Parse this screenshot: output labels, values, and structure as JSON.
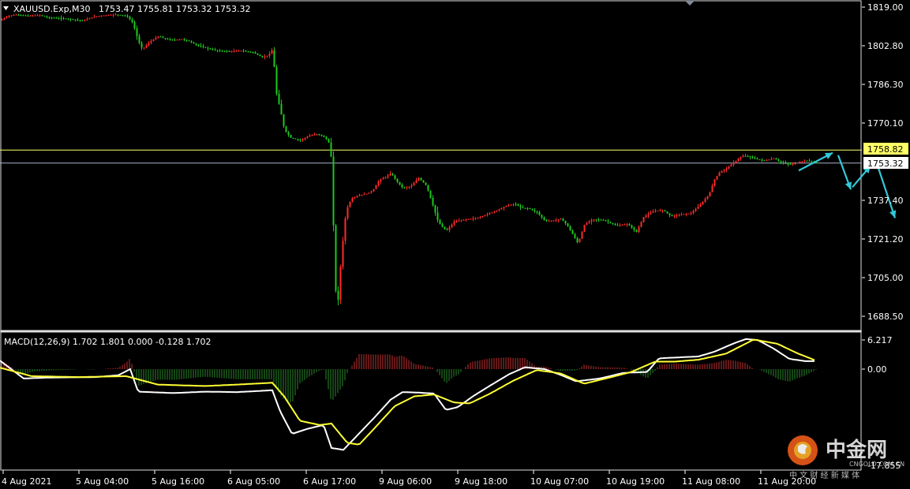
{
  "header": {
    "symbol_label": "XAUUSD.Exp,M30",
    "ohlc_label": "1753.47 1755.81 1753.32 1753.32",
    "menu_icon": "triangle-down-icon"
  },
  "macd": {
    "label": "MACD(12,26,9) 1.702 1.801 0.000 -0.128 1.702",
    "axis_top": "6.217",
    "axis_zero": "0.00",
    "axis_bottom": "-17.855"
  },
  "price_axis": {
    "ticks": [
      "1819.00",
      "1802.80",
      "1786.30",
      "1770.10",
      "1737.40",
      "1721.20",
      "1705.00",
      "1688.50"
    ],
    "resistance_label": "1758.82",
    "current_label": "1753.32"
  },
  "time_axis": {
    "ticks": [
      "4 Aug 2021",
      "5 Aug 04:00",
      "5 Aug 16:00",
      "6 Aug 05:00",
      "6 Aug 17:00",
      "9 Aug 06:00",
      "9 Aug 18:00",
      "10 Aug 07:00",
      "10 Aug 19:00",
      "11 Aug 08:00",
      "11 Aug 20:00"
    ]
  },
  "watermark": {
    "name_cn": "中金网",
    "sub_cn": "中 文 财 经 新 媒 体",
    "domain": "CNGOLD.COM.CN"
  },
  "colors": {
    "bull": "#ff2a2a",
    "bear": "#1ec81e",
    "resistance_line": "#ffff66",
    "current_line": "#a8b4c8",
    "forecast_arrow": "#33c8d8",
    "macd_main": "#ffffff",
    "macd_signal": "#ffff33",
    "hist_pos": "#c83030",
    "hist_neg": "#2a8a2a",
    "logo_accent": "#e85a1a"
  },
  "chart_data": {
    "type": "candlestick",
    "instrument": "XAUUSD.Exp",
    "timeframe": "M30",
    "y_range": [
      1681,
      1823
    ],
    "resistance_level": 1758.82,
    "current_price": 1753.32,
    "price_path_anchors": [
      [
        0,
        1813.4
      ],
      [
        10,
        1815.3
      ],
      [
        20,
        1815.8
      ],
      [
        35,
        1815.3
      ],
      [
        50,
        1815.6
      ],
      [
        60,
        1814.6
      ],
      [
        75,
        1814.3
      ],
      [
        90,
        1813.9
      ],
      [
        105,
        1813.2
      ],
      [
        115,
        1814.6
      ],
      [
        125,
        1815.3
      ],
      [
        135,
        1815.6
      ],
      [
        145,
        1815.9
      ],
      [
        160,
        1815.3
      ],
      [
        168,
        1812.3
      ],
      [
        175,
        1804.5
      ],
      [
        180,
        1801.3
      ],
      [
        190,
        1804.5
      ],
      [
        200,
        1806.6
      ],
      [
        210,
        1805.5
      ],
      [
        220,
        1805.1
      ],
      [
        230,
        1805.5
      ],
      [
        240,
        1804.5
      ],
      [
        250,
        1802.8
      ],
      [
        260,
        1801.8
      ],
      [
        275,
        1800.6
      ],
      [
        290,
        1800.3
      ],
      [
        305,
        1800.6
      ],
      [
        320,
        1799.9
      ],
      [
        332,
        1797.8
      ],
      [
        340,
        1798.7
      ],
      [
        345,
        1801.3
      ],
      [
        350,
        1782.4
      ],
      [
        355,
        1775.3
      ],
      [
        360,
        1767.1
      ],
      [
        368,
        1763.8
      ],
      [
        380,
        1762.8
      ],
      [
        392,
        1764.8
      ],
      [
        402,
        1765.5
      ],
      [
        412,
        1763.8
      ],
      [
        418,
        1760.9
      ],
      [
        420,
        1750.9
      ],
      [
        422,
        1726.9
      ],
      [
        424,
        1700.5
      ],
      [
        428,
        1695.5
      ],
      [
        432,
        1714.0
      ],
      [
        438,
        1733.0
      ],
      [
        445,
        1738.3
      ],
      [
        455,
        1739.6
      ],
      [
        465,
        1740.3
      ],
      [
        472,
        1741.6
      ],
      [
        480,
        1745.9
      ],
      [
        488,
        1747.3
      ],
      [
        495,
        1748.9
      ],
      [
        502,
        1745.6
      ],
      [
        510,
        1742.6
      ],
      [
        520,
        1743.3
      ],
      [
        530,
        1746.9
      ],
      [
        540,
        1743.6
      ],
      [
        548,
        1735.4
      ],
      [
        555,
        1728.1
      ],
      [
        565,
        1724.5
      ],
      [
        575,
        1728.4
      ],
      [
        590,
        1729.4
      ],
      [
        605,
        1730.0
      ],
      [
        620,
        1732.0
      ],
      [
        630,
        1733.3
      ],
      [
        640,
        1735.0
      ],
      [
        652,
        1736.0
      ],
      [
        660,
        1734.3
      ],
      [
        670,
        1734.0
      ],
      [
        680,
        1732.4
      ],
      [
        690,
        1728.8
      ],
      [
        700,
        1728.8
      ],
      [
        710,
        1729.7
      ],
      [
        718,
        1727.1
      ],
      [
        725,
        1723.2
      ],
      [
        732,
        1719.2
      ],
      [
        740,
        1727.1
      ],
      [
        750,
        1729.4
      ],
      [
        765,
        1729.1
      ],
      [
        780,
        1726.8
      ],
      [
        795,
        1727.4
      ],
      [
        806,
        1724.1
      ],
      [
        815,
        1730.4
      ],
      [
        828,
        1733.0
      ],
      [
        840,
        1733.3
      ],
      [
        850,
        1730.7
      ],
      [
        860,
        1731.4
      ],
      [
        875,
        1732.0
      ],
      [
        888,
        1736.0
      ],
      [
        898,
        1740.0
      ],
      [
        905,
        1746.3
      ],
      [
        912,
        1749.5
      ],
      [
        920,
        1750.9
      ],
      [
        930,
        1753.6
      ],
      [
        940,
        1756.2
      ],
      [
        950,
        1755.9
      ],
      [
        960,
        1754.6
      ],
      [
        970,
        1754.3
      ],
      [
        980,
        1755.2
      ],
      [
        990,
        1753.3
      ],
      [
        1000,
        1752.6
      ],
      [
        1010,
        1753.3
      ],
      [
        1020,
        1754.3
      ],
      [
        1034,
        1753.32
      ]
    ],
    "forecast_arrows": [
      {
        "from": [
          1012,
          1750.0
        ],
        "to": [
          1055,
          1757.5
        ]
      },
      {
        "from": [
          1062,
          1756.5
        ],
        "to": [
          1078,
          1742.0
        ]
      },
      {
        "from": [
          1080,
          1743.0
        ],
        "to": [
          1103,
          1752.0
        ]
      },
      {
        "from": [
          1113,
          1751.0
        ],
        "to": [
          1134,
          1730.0
        ]
      }
    ],
    "macd_range": [
      -17.855,
      6.217
    ],
    "macd_main_anchors": [
      [
        0,
        1.8
      ],
      [
        30,
        -2.0
      ],
      [
        60,
        -1.8
      ],
      [
        120,
        -1.7
      ],
      [
        150,
        -1.3
      ],
      [
        165,
        0.0
      ],
      [
        175,
        -4.8
      ],
      [
        190,
        -4.9
      ],
      [
        220,
        -5.1
      ],
      [
        260,
        -4.8
      ],
      [
        300,
        -4.9
      ],
      [
        345,
        -4.5
      ],
      [
        355,
        -9.0
      ],
      [
        370,
        -13.8
      ],
      [
        390,
        -12.7
      ],
      [
        410,
        -11.9
      ],
      [
        420,
        -16.8
      ],
      [
        435,
        -17.2
      ],
      [
        450,
        -14.6
      ],
      [
        475,
        -10.2
      ],
      [
        495,
        -6.5
      ],
      [
        510,
        -4.9
      ],
      [
        530,
        -5.0
      ],
      [
        550,
        -5.2
      ],
      [
        565,
        -8.7
      ],
      [
        580,
        -8.1
      ],
      [
        600,
        -5.7
      ],
      [
        625,
        -3.1
      ],
      [
        645,
        -1.1
      ],
      [
        665,
        0.4
      ],
      [
        690,
        0.0
      ],
      [
        710,
        -1.2
      ],
      [
        730,
        -2.6
      ],
      [
        760,
        -2.0
      ],
      [
        790,
        -0.8
      ],
      [
        820,
        -0.6
      ],
      [
        835,
        2.3
      ],
      [
        860,
        2.5
      ],
      [
        885,
        2.7
      ],
      [
        905,
        3.7
      ],
      [
        930,
        5.5
      ],
      [
        945,
        6.4
      ],
      [
        960,
        6.2
      ],
      [
        980,
        4.4
      ],
      [
        1000,
        2.2
      ],
      [
        1020,
        1.7
      ],
      [
        1034,
        1.7
      ]
    ],
    "macd_signal_anchors": [
      [
        0,
        0.3
      ],
      [
        40,
        -1.5
      ],
      [
        100,
        -1.7
      ],
      [
        160,
        -1.5
      ],
      [
        200,
        -3.3
      ],
      [
        260,
        -3.6
      ],
      [
        300,
        -3.3
      ],
      [
        345,
        -2.9
      ],
      [
        360,
        -5.8
      ],
      [
        380,
        -11.0
      ],
      [
        405,
        -11.9
      ],
      [
        420,
        -11.6
      ],
      [
        440,
        -15.7
      ],
      [
        455,
        -16.1
      ],
      [
        475,
        -12.5
      ],
      [
        500,
        -7.9
      ],
      [
        525,
        -5.8
      ],
      [
        550,
        -5.4
      ],
      [
        575,
        -7.1
      ],
      [
        595,
        -7.3
      ],
      [
        620,
        -5.3
      ],
      [
        650,
        -2.5
      ],
      [
        680,
        -0.2
      ],
      [
        710,
        -0.9
      ],
      [
        740,
        -3.1
      ],
      [
        770,
        -1.9
      ],
      [
        800,
        -0.6
      ],
      [
        830,
        1.6
      ],
      [
        855,
        1.6
      ],
      [
        885,
        2.0
      ],
      [
        920,
        3.3
      ],
      [
        955,
        6.3
      ],
      [
        985,
        5.4
      ],
      [
        1010,
        3.4
      ],
      [
        1034,
        1.8
      ]
    ]
  }
}
